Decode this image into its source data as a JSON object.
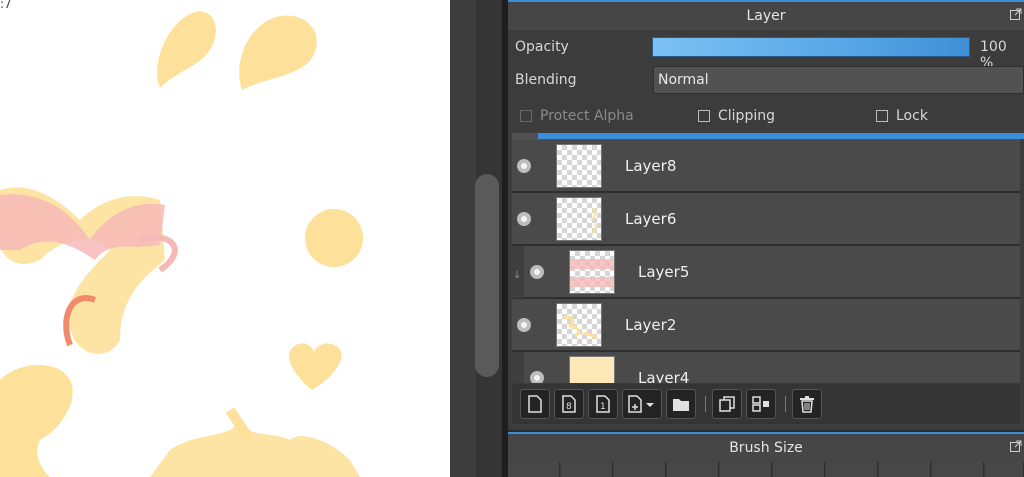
{
  "layer_panel": {
    "title": "Layer",
    "opacity_label": "Opacity",
    "opacity_value": "100 %",
    "opacity_fraction": 1.0,
    "blending_label": "Blending",
    "blending_value": "Normal",
    "protect_alpha_label": "Protect Alpha",
    "clipping_label": "Clipping",
    "lock_label": "Lock",
    "layers": [
      {
        "name": "Layer8",
        "visible": true,
        "clipped": false
      },
      {
        "name": "Layer6",
        "visible": true,
        "clipped": false
      },
      {
        "name": "Layer5",
        "visible": true,
        "clipped": true
      },
      {
        "name": "Layer2",
        "visible": true,
        "clipped": false
      },
      {
        "name": "Layer4",
        "visible": true,
        "clipped": true
      }
    ],
    "toolbar_icons": [
      "new-layer-icon",
      "new-8bit-layer-icon",
      "new-1bit-layer-icon",
      "add-layer-dropdown-icon",
      "new-folder-icon",
      "duplicate-layer-icon",
      "merge-down-icon",
      "delete-layer-icon"
    ]
  },
  "brush_panel": {
    "title": "Brush Size"
  },
  "colors": {
    "accent": "#3a8fd8",
    "canvas_yellow": "#fde19a",
    "canvas_pink": "#f7b8b8"
  }
}
